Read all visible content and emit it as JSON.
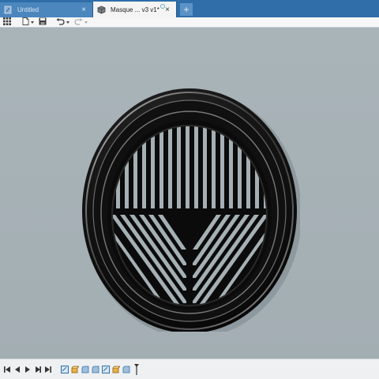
{
  "tabs": [
    {
      "label": "Untitled",
      "icon": "sketch-document-icon",
      "active": false
    },
    {
      "label": "Masque ... v3 v1*",
      "icon": "component-document-icon",
      "active": true
    }
  ],
  "new_tab_label": "+",
  "tab_close_glyph": "×",
  "toolbar": {
    "items": [
      "grid-menu-icon",
      "file-menu-icon",
      "save-icon",
      "undo-icon",
      "redo-icon"
    ]
  },
  "viewport": {
    "object": "vented-circular-cover",
    "colors": {
      "background": "#a5b0b5",
      "body": "#141414",
      "highlight": "#e6e6e6"
    }
  },
  "timeline": {
    "controls": [
      "first-step-icon",
      "previous-step-icon",
      "play-icon",
      "next-step-icon",
      "last-step-icon"
    ],
    "features": [
      "sketch-feature-icon",
      "extrude-feature-icon",
      "fillet-feature-icon",
      "fillet-feature-icon",
      "sketch-feature-icon",
      "extrude-feature-icon",
      "fillet-feature-icon"
    ]
  },
  "colors": {
    "tabbar": "#2f6ea8",
    "active_tab": "#f4f4f4",
    "toolbar": "#f6f6f6",
    "timeline": "#eef0f1"
  }
}
